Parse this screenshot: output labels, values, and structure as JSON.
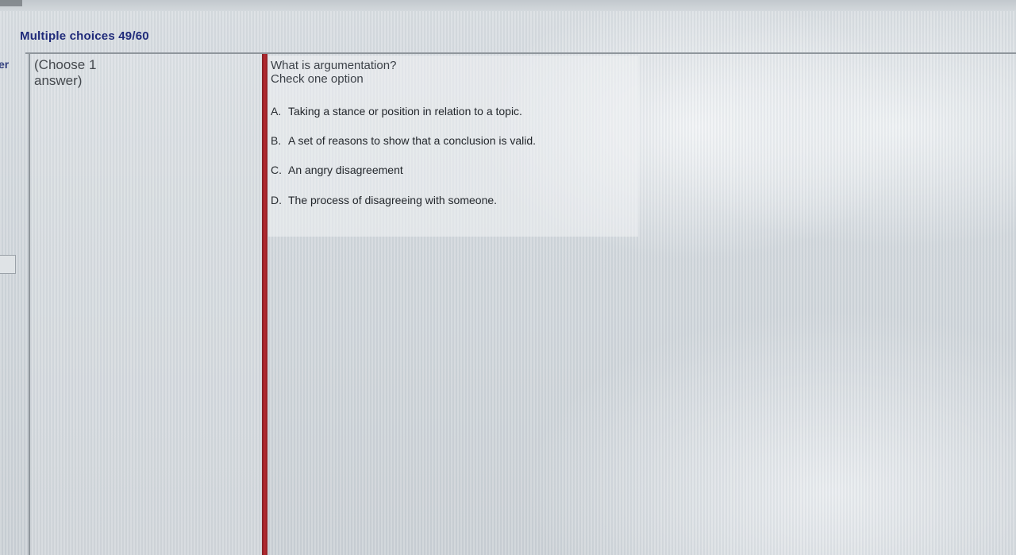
{
  "header": {
    "title": "Multiple choices 49/60",
    "left_edge_text": "er"
  },
  "instruction": {
    "line1": "(Choose 1",
    "line2": "answer)"
  },
  "question": {
    "text": "What is argumentation?",
    "hint": "Check one option"
  },
  "options": [
    {
      "letter": "A.",
      "text": "Taking a stance or position in relation to a topic."
    },
    {
      "letter": "B.",
      "text": "A set of reasons to show that a conclusion is valid."
    },
    {
      "letter": "C.",
      "text": "An angry disagreement"
    },
    {
      "letter": "D.",
      "text": "The process of disagreeing with someone."
    }
  ],
  "colors": {
    "title": "#1f2a7a",
    "divider": "#b8282f"
  }
}
